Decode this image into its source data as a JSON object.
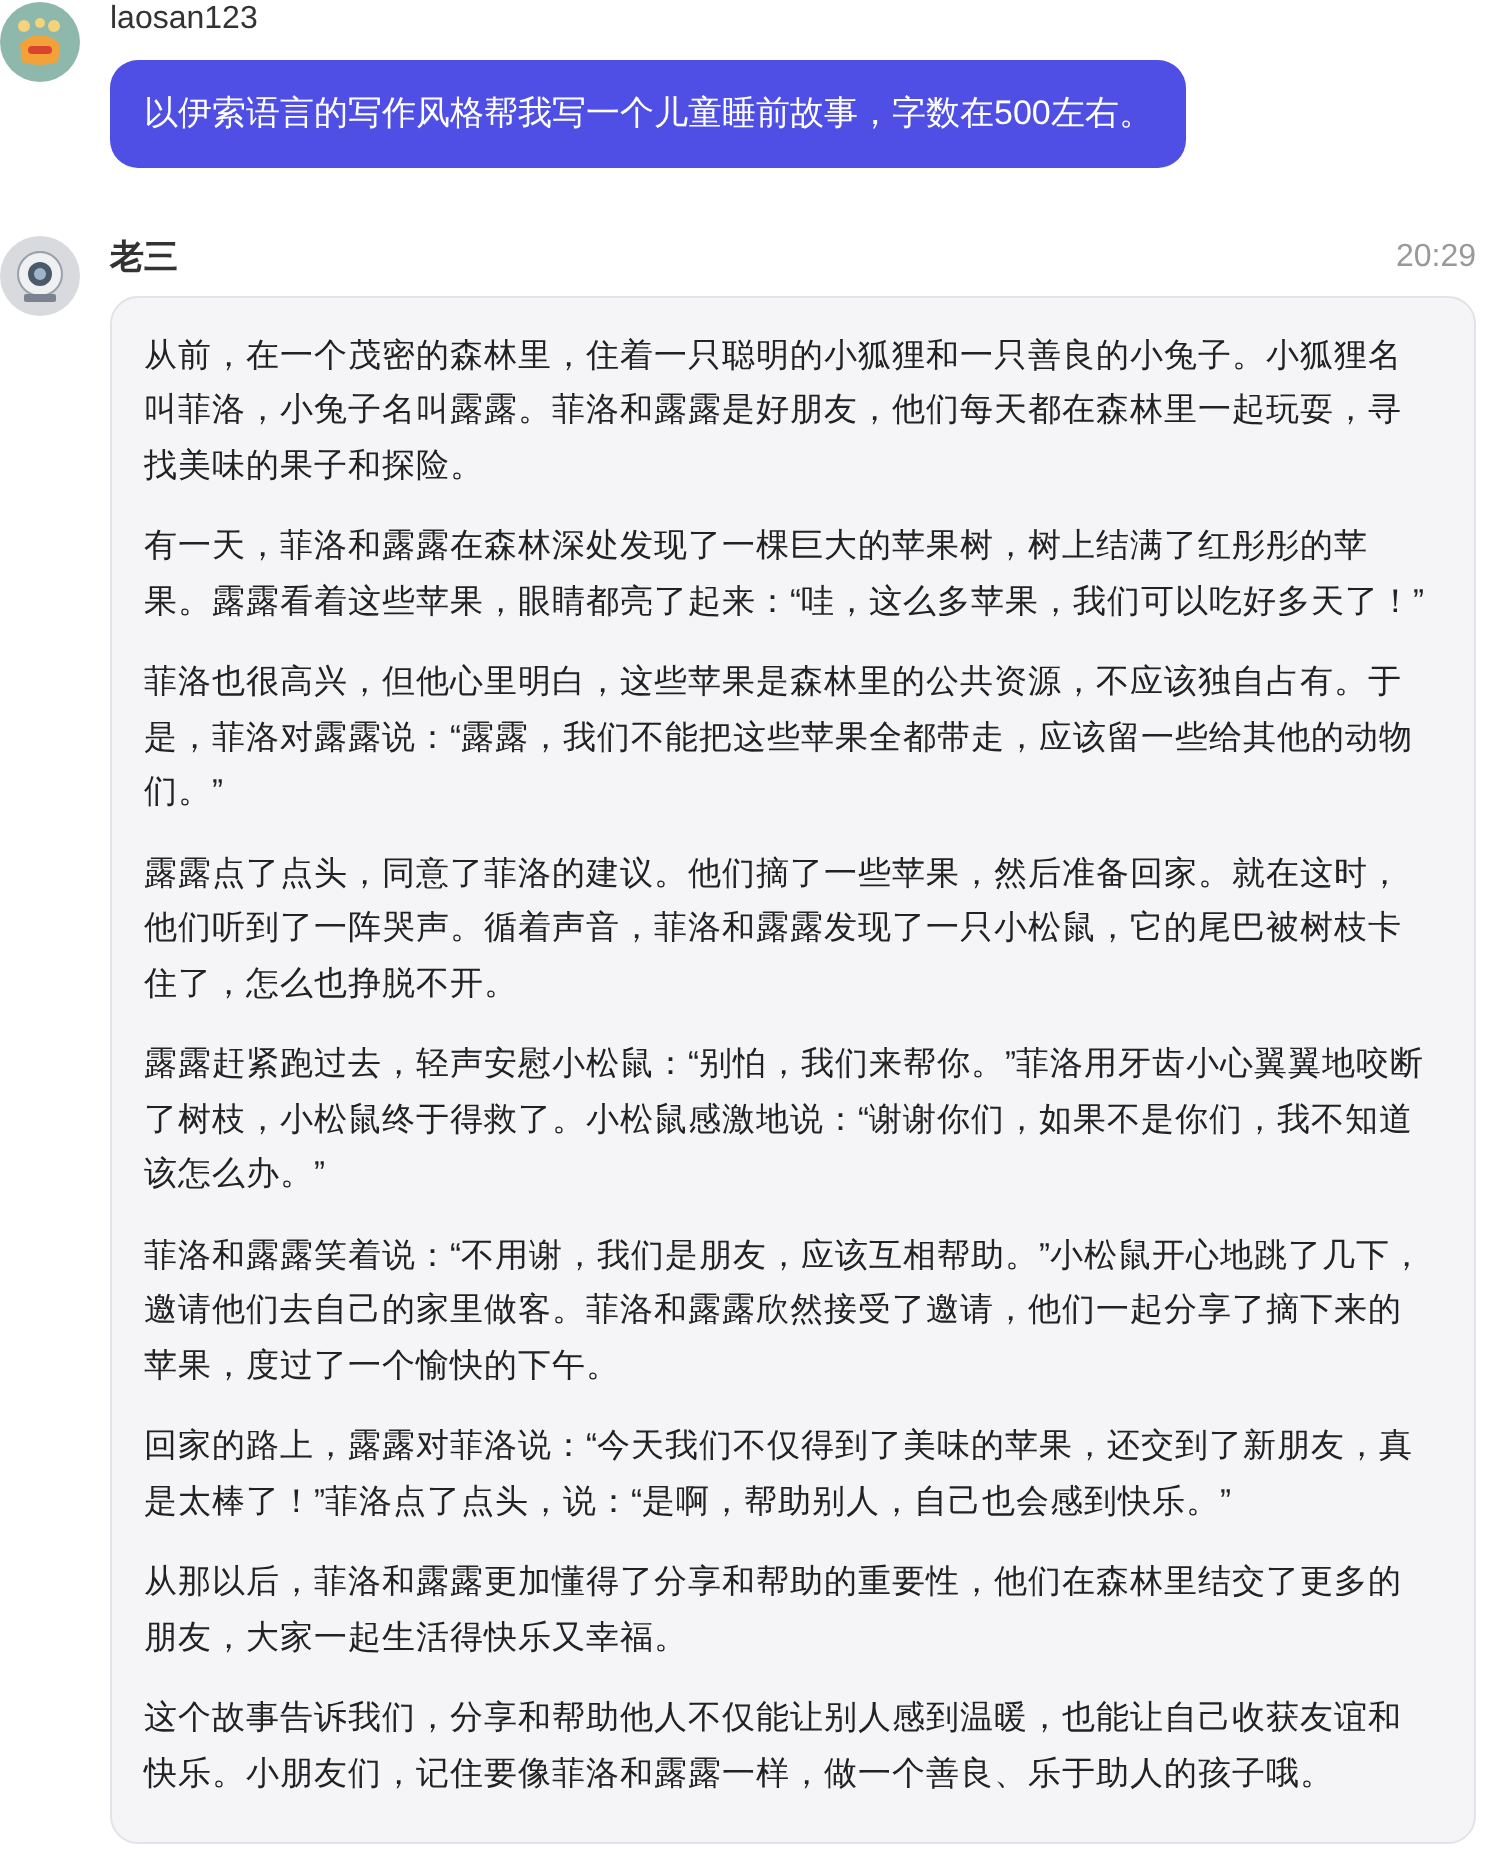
{
  "user_message": {
    "username": "laosan123",
    "text": "以伊索语言的写作风格帮我写一个儿童睡前故事，字数在500左右。"
  },
  "bot_message": {
    "name": "老三",
    "time": "20:29",
    "paragraphs": [
      "从前，在一个茂密的森林里，住着一只聪明的小狐狸和一只善良的小兔子。小狐狸名叫菲洛，小兔子名叫露露。菲洛和露露是好朋友，他们每天都在森林里一起玩耍，寻找美味的果子和探险。",
      "有一天，菲洛和露露在森林深处发现了一棵巨大的苹果树，树上结满了红彤彤的苹果。露露看着这些苹果，眼睛都亮了起来：“哇，这么多苹果，我们可以吃好多天了！”",
      "菲洛也很高兴，但他心里明白，这些苹果是森林里的公共资源，不应该独自占有。于是，菲洛对露露说：“露露，我们不能把这些苹果全都带走，应该留一些给其他的动物们。”",
      "露露点了点头，同意了菲洛的建议。他们摘了一些苹果，然后准备回家。就在这时，他们听到了一阵哭声。循着声音，菲洛和露露发现了一只小松鼠，它的尾巴被树枝卡住了，怎么也挣脱不开。",
      "露露赶紧跑过去，轻声安慰小松鼠：“别怕，我们来帮你。”菲洛用牙齿小心翼翼地咬断了树枝，小松鼠终于得救了。小松鼠感激地说：“谢谢你们，如果不是你们，我不知道该怎么办。”",
      "菲洛和露露笑着说：“不用谢，我们是朋友，应该互相帮助。”小松鼠开心地跳了几下，邀请他们去自己的家里做客。菲洛和露露欣然接受了邀请，他们一起分享了摘下来的苹果，度过了一个愉快的下午。",
      "回家的路上，露露对菲洛说：“今天我们不仅得到了美味的苹果，还交到了新朋友，真是太棒了！”菲洛点了点头，说：“是啊，帮助别人，自己也会感到快乐。”",
      "从那以后，菲洛和露露更加懂得了分享和帮助的重要性，他们在森林里结交了更多的朋友，大家一起生活得快乐又幸福。",
      "这个故事告诉我们，分享和帮助他人不仅能让别人感到温暖，也能让自己收获友谊和快乐。小朋友们，记住要像菲洛和露露一样，做一个善良、乐于助人的孩子哦。"
    ]
  }
}
